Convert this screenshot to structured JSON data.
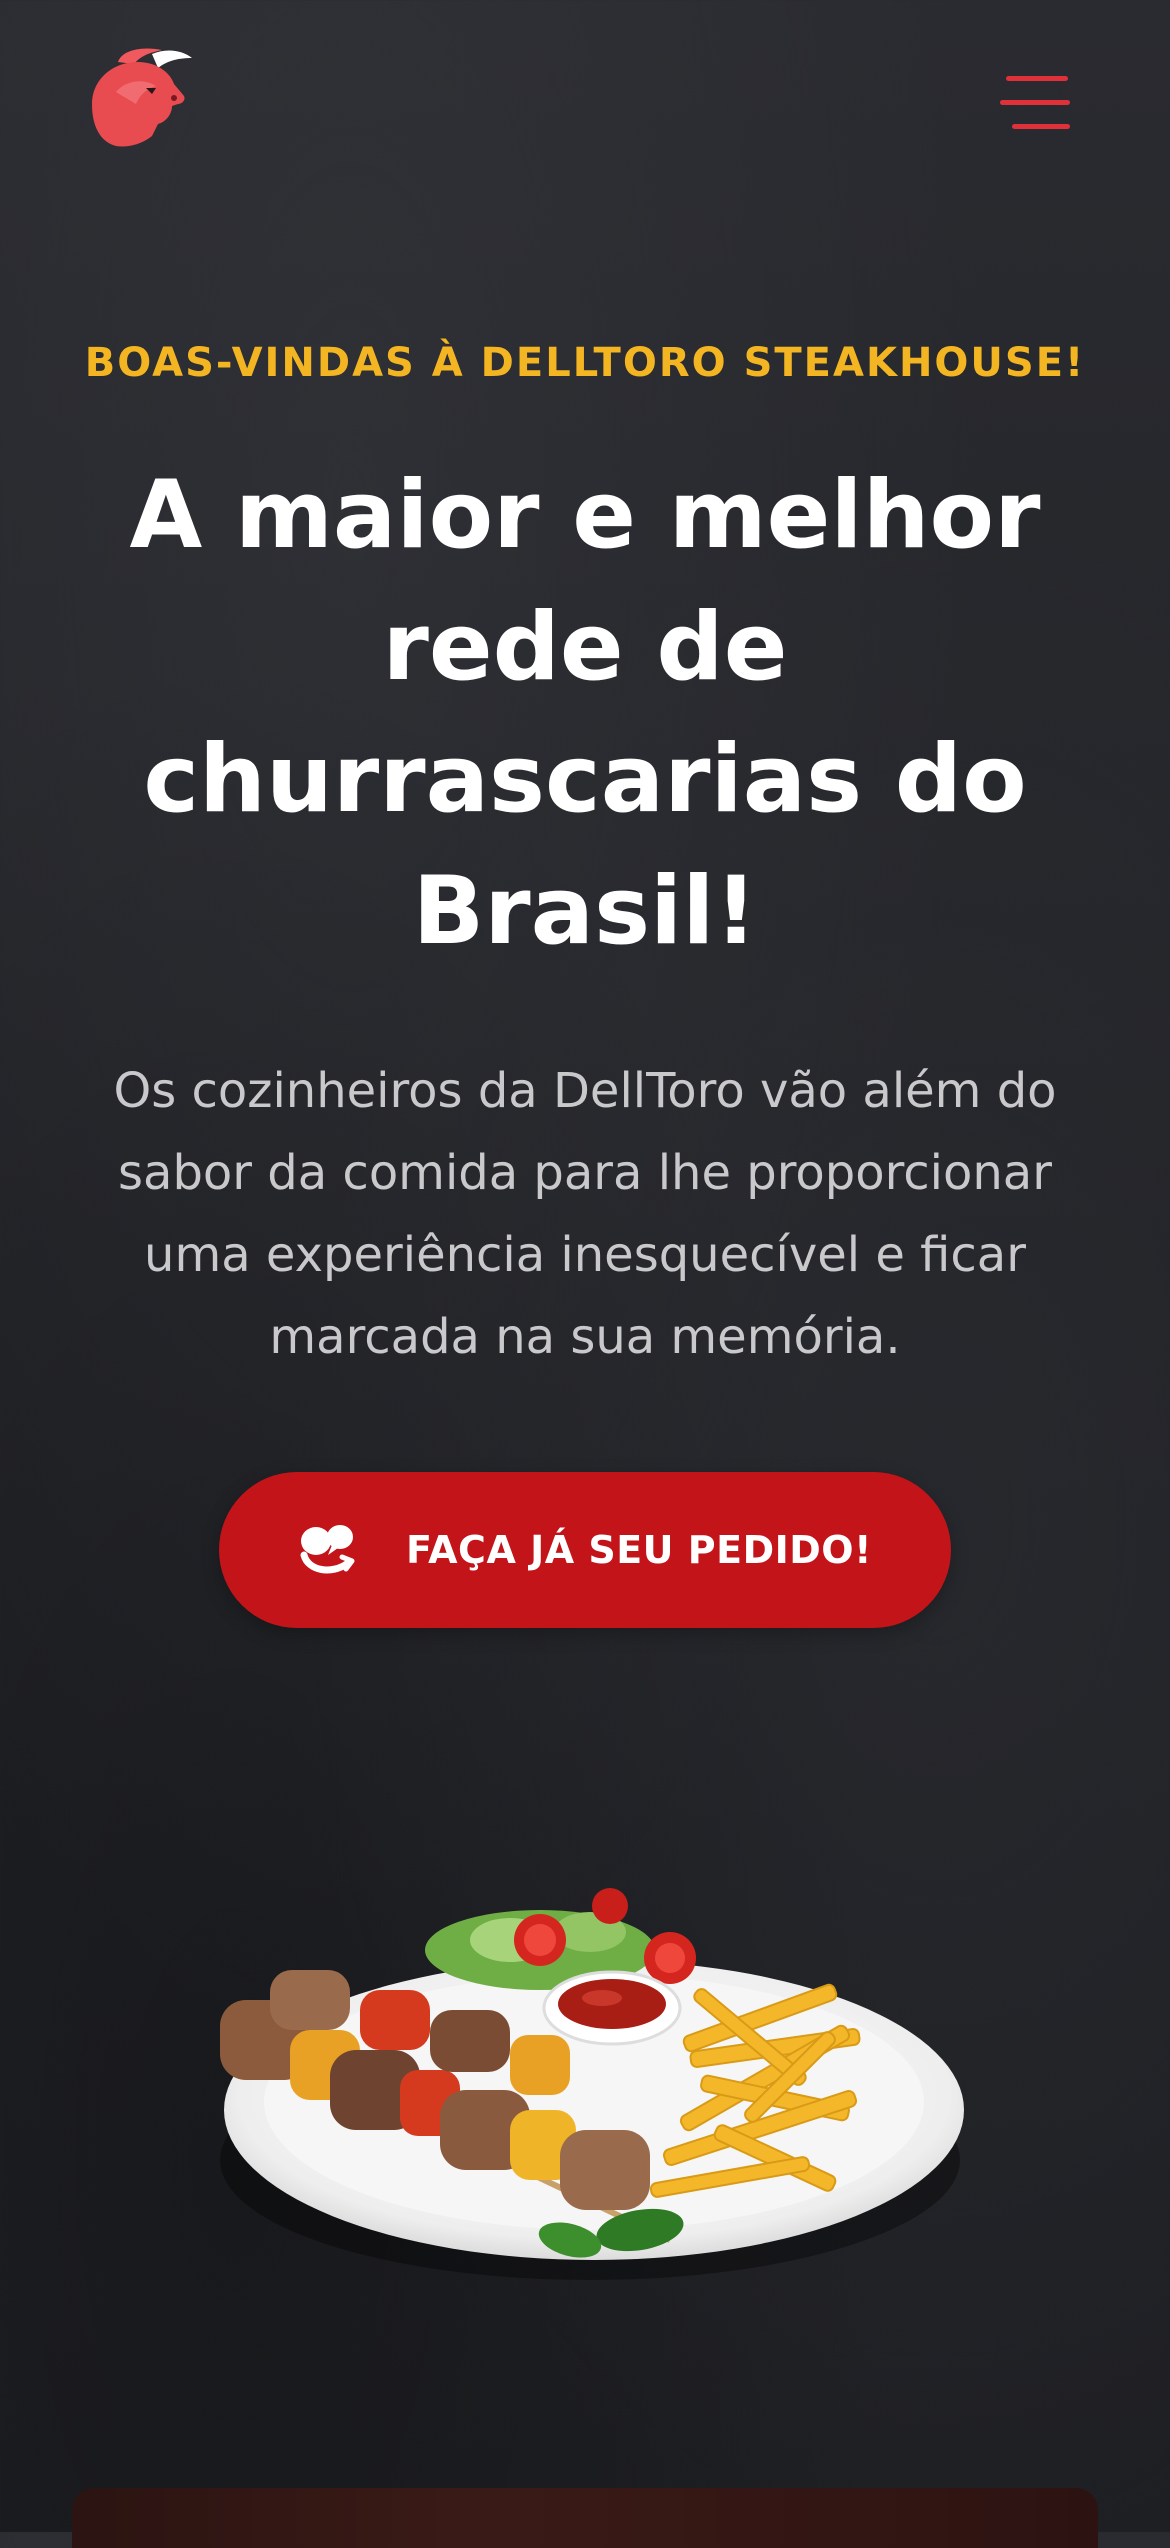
{
  "header": {
    "logo_icon": "bull-head-logo-icon",
    "menu_icon": "hamburger-menu-icon",
    "accent_color": "#e0313a"
  },
  "hero": {
    "eyebrow": "BOAS-VINDAS À DELLTORO STEAKHOUSE!",
    "headline_lines": [
      "A maior e melhor",
      "rede de",
      "churrascarias do",
      "Brasil!"
    ],
    "lead_lines": [
      "Os cozinheiros da DellToro vão além do",
      "sabor da comida para lhe proporcionar",
      "uma experiência inesquecível e ficar",
      "marcada na sua memória."
    ],
    "cta": {
      "label": "FAÇA JÁ SEU PEDIDO!",
      "icon": "chat-bubbles-icon",
      "color": "#c31519"
    },
    "image": "plate-skewers-fries-salad-image"
  },
  "colors": {
    "eyebrow": "#f3b522",
    "background": "#232428",
    "lead_text": "#c9c9cc"
  }
}
